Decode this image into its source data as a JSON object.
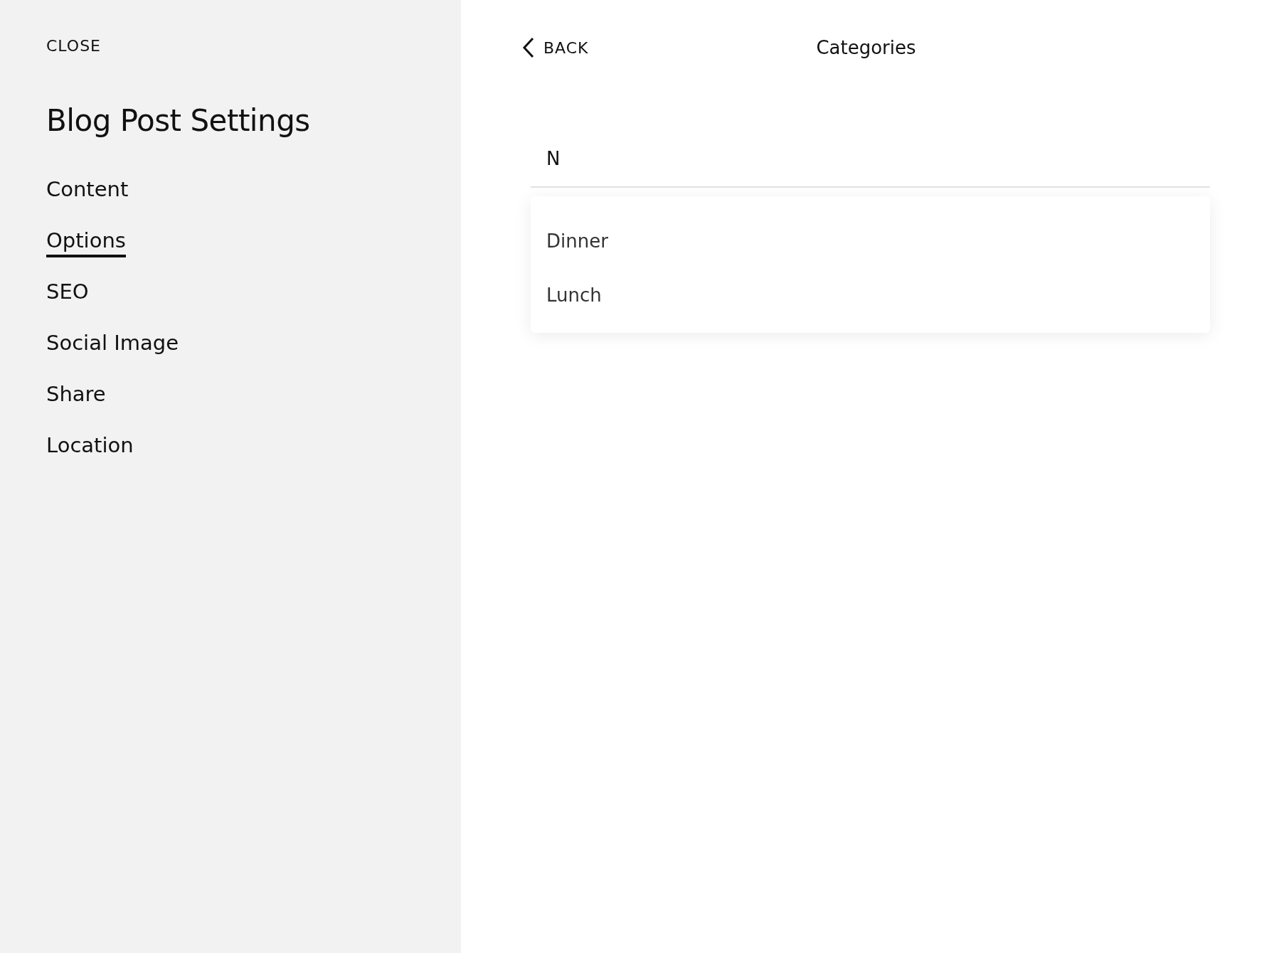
{
  "sidebar": {
    "close": "CLOSE",
    "title": "Blog Post Settings",
    "items": [
      {
        "label": "Content",
        "selected": false
      },
      {
        "label": "Options",
        "selected": true
      },
      {
        "label": "SEO",
        "selected": false
      },
      {
        "label": "Social Image",
        "selected": false
      },
      {
        "label": "Share",
        "selected": false
      },
      {
        "label": "Location",
        "selected": false
      }
    ]
  },
  "panel": {
    "back": "BACK",
    "title": "Categories",
    "search": {
      "value": "N"
    },
    "suggestions": [
      "Dinner",
      "Lunch"
    ]
  }
}
